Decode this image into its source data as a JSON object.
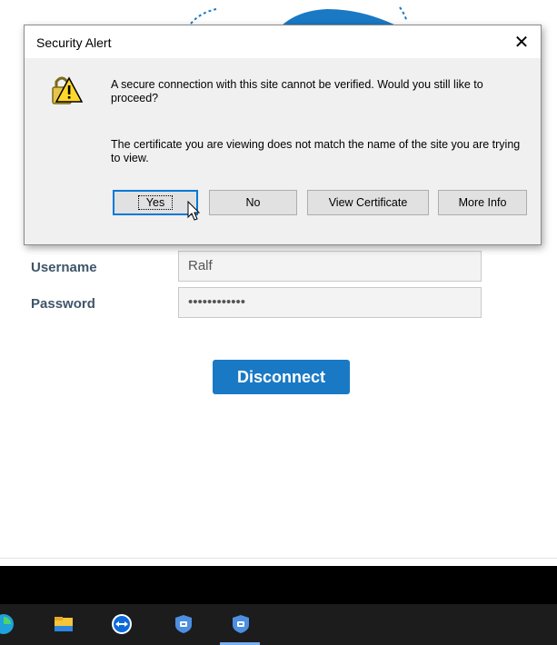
{
  "dialog": {
    "title": "Security Alert",
    "close_glyph": "✕",
    "icon": "warning-lock-icon",
    "message1": "A secure connection with this site cannot be verified. Would you still like to proceed?",
    "message2": "The certificate you are viewing does not match the name of the site you are trying to view.",
    "buttons": {
      "yes": "Yes",
      "no": "No",
      "view_certificate": "View Certificate",
      "more_info": "More Info"
    }
  },
  "form": {
    "username_label": "Username",
    "username_value": "Ralf",
    "password_label": "Password",
    "password_value": "••••••••••••",
    "disconnect_label": "Disconnect"
  },
  "taskbar": {
    "icons": [
      "edge-icon",
      "file-explorer-icon",
      "teamviewer-icon",
      "app-icon",
      "app-icon"
    ]
  },
  "colors": {
    "accent": "#1a79c4",
    "label": "#3f5569"
  }
}
